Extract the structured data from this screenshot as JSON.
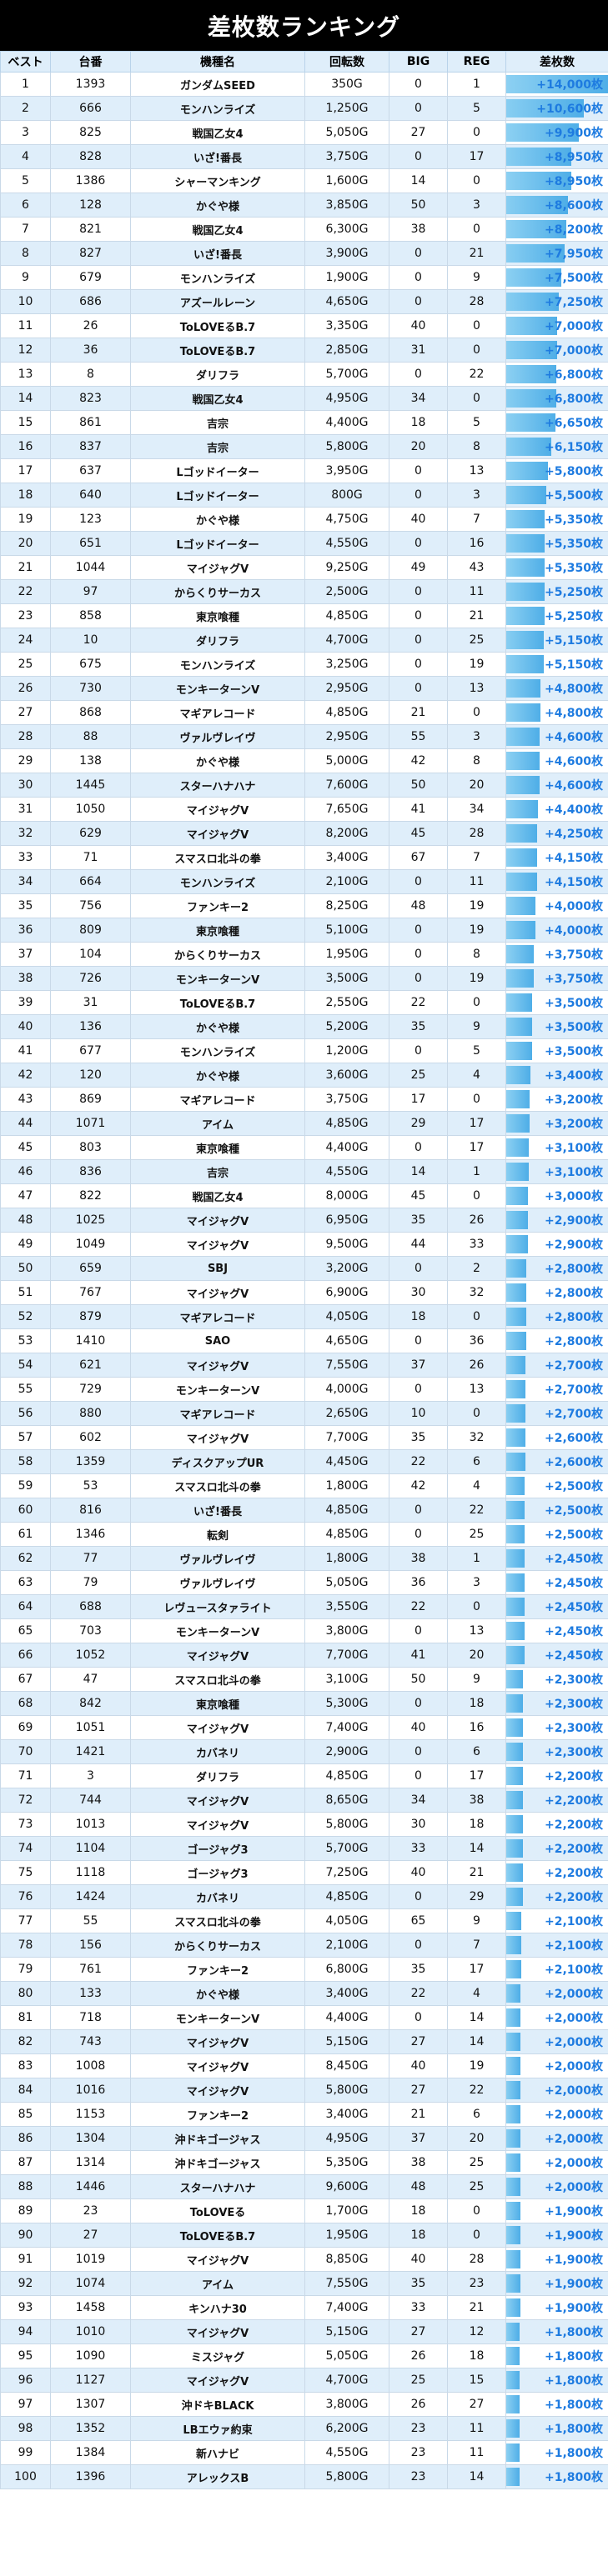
{
  "title": "差枚数ランキング",
  "headers": [
    "ベスト",
    "台番",
    "機種名",
    "回転数",
    "BIG",
    "REG",
    "差枚数"
  ],
  "colors": {
    "banner": "#000000",
    "header_bg": "#dfeefa",
    "stripe": "#dfeefa",
    "diff_text": "#1e7be0",
    "bar": "#5ab4e8"
  },
  "rows": [
    [
      "1",
      "1393",
      "ガンダムSEED",
      "350G",
      "0",
      "1",
      "+14,000枚"
    ],
    [
      "2",
      "666",
      "モンハンライズ",
      "1,250G",
      "0",
      "5",
      "+10,600枚"
    ],
    [
      "3",
      "825",
      "戦国乙女4",
      "5,050G",
      "27",
      "0",
      "+9,900枚"
    ],
    [
      "4",
      "828",
      "いざ!番長",
      "3,750G",
      "0",
      "17",
      "+8,950枚"
    ],
    [
      "5",
      "1386",
      "シャーマンキング",
      "1,600G",
      "14",
      "0",
      "+8,950枚"
    ],
    [
      "6",
      "128",
      "かぐや様",
      "3,850G",
      "50",
      "3",
      "+8,600枚"
    ],
    [
      "7",
      "821",
      "戦国乙女4",
      "6,300G",
      "38",
      "0",
      "+8,200枚"
    ],
    [
      "8",
      "827",
      "いざ!番長",
      "3,900G",
      "0",
      "21",
      "+7,950枚"
    ],
    [
      "9",
      "679",
      "モンハンライズ",
      "1,900G",
      "0",
      "9",
      "+7,500枚"
    ],
    [
      "10",
      "686",
      "アズールレーン",
      "4,650G",
      "0",
      "28",
      "+7,250枚"
    ],
    [
      "11",
      "26",
      "ToLOVEるB.7",
      "3,350G",
      "40",
      "0",
      "+7,000枚"
    ],
    [
      "12",
      "36",
      "ToLOVEるB.7",
      "2,850G",
      "31",
      "0",
      "+7,000枚"
    ],
    [
      "13",
      "8",
      "ダリフラ",
      "5,700G",
      "0",
      "22",
      "+6,800枚"
    ],
    [
      "14",
      "823",
      "戦国乙女4",
      "4,950G",
      "34",
      "0",
      "+6,800枚"
    ],
    [
      "15",
      "861",
      "吉宗",
      "4,400G",
      "18",
      "5",
      "+6,650枚"
    ],
    [
      "16",
      "837",
      "吉宗",
      "5,800G",
      "20",
      "8",
      "+6,150枚"
    ],
    [
      "17",
      "637",
      "Lゴッドイーター",
      "3,950G",
      "0",
      "13",
      "+5,800枚"
    ],
    [
      "18",
      "640",
      "Lゴッドイーター",
      "800G",
      "0",
      "3",
      "+5,500枚"
    ],
    [
      "19",
      "123",
      "かぐや様",
      "4,750G",
      "40",
      "7",
      "+5,350枚"
    ],
    [
      "20",
      "651",
      "Lゴッドイーター",
      "4,550G",
      "0",
      "16",
      "+5,350枚"
    ],
    [
      "21",
      "1044",
      "マイジャグV",
      "9,250G",
      "49",
      "43",
      "+5,350枚"
    ],
    [
      "22",
      "97",
      "からくりサーカス",
      "2,500G",
      "0",
      "11",
      "+5,250枚"
    ],
    [
      "23",
      "858",
      "東京喰種",
      "4,850G",
      "0",
      "21",
      "+5,250枚"
    ],
    [
      "24",
      "10",
      "ダリフラ",
      "4,700G",
      "0",
      "25",
      "+5,150枚"
    ],
    [
      "25",
      "675",
      "モンハンライズ",
      "3,250G",
      "0",
      "19",
      "+5,150枚"
    ],
    [
      "26",
      "730",
      "モンキーターンV",
      "2,950G",
      "0",
      "13",
      "+4,800枚"
    ],
    [
      "27",
      "868",
      "マギアレコード",
      "4,850G",
      "21",
      "0",
      "+4,800枚"
    ],
    [
      "28",
      "88",
      "ヴァルヴレイヴ",
      "2,950G",
      "55",
      "3",
      "+4,600枚"
    ],
    [
      "29",
      "138",
      "かぐや様",
      "5,000G",
      "42",
      "8",
      "+4,600枚"
    ],
    [
      "30",
      "1445",
      "スターハナハナ",
      "7,600G",
      "50",
      "20",
      "+4,600枚"
    ],
    [
      "31",
      "1050",
      "マイジャグV",
      "7,650G",
      "41",
      "34",
      "+4,400枚"
    ],
    [
      "32",
      "629",
      "マイジャグV",
      "8,200G",
      "45",
      "28",
      "+4,250枚"
    ],
    [
      "33",
      "71",
      "スマスロ北斗の拳",
      "3,400G",
      "67",
      "7",
      "+4,150枚"
    ],
    [
      "34",
      "664",
      "モンハンライズ",
      "2,100G",
      "0",
      "11",
      "+4,150枚"
    ],
    [
      "35",
      "756",
      "ファンキー2",
      "8,250G",
      "48",
      "19",
      "+4,000枚"
    ],
    [
      "36",
      "809",
      "東京喰種",
      "5,100G",
      "0",
      "19",
      "+4,000枚"
    ],
    [
      "37",
      "104",
      "からくりサーカス",
      "1,950G",
      "0",
      "8",
      "+3,750枚"
    ],
    [
      "38",
      "726",
      "モンキーターンV",
      "3,500G",
      "0",
      "19",
      "+3,750枚"
    ],
    [
      "39",
      "31",
      "ToLOVEるB.7",
      "2,550G",
      "22",
      "0",
      "+3,500枚"
    ],
    [
      "40",
      "136",
      "かぐや様",
      "5,200G",
      "35",
      "9",
      "+3,500枚"
    ],
    [
      "41",
      "677",
      "モンハンライズ",
      "1,200G",
      "0",
      "5",
      "+3,500枚"
    ],
    [
      "42",
      "120",
      "かぐや様",
      "3,600G",
      "25",
      "4",
      "+3,400枚"
    ],
    [
      "43",
      "869",
      "マギアレコード",
      "3,750G",
      "17",
      "0",
      "+3,200枚"
    ],
    [
      "44",
      "1071",
      "アイム",
      "4,850G",
      "29",
      "17",
      "+3,200枚"
    ],
    [
      "45",
      "803",
      "東京喰種",
      "4,400G",
      "0",
      "17",
      "+3,100枚"
    ],
    [
      "46",
      "836",
      "吉宗",
      "4,550G",
      "14",
      "1",
      "+3,100枚"
    ],
    [
      "47",
      "822",
      "戦国乙女4",
      "8,000G",
      "45",
      "0",
      "+3,000枚"
    ],
    [
      "48",
      "1025",
      "マイジャグV",
      "6,950G",
      "35",
      "26",
      "+2,900枚"
    ],
    [
      "49",
      "1049",
      "マイジャグV",
      "9,500G",
      "44",
      "33",
      "+2,900枚"
    ],
    [
      "50",
      "659",
      "SBJ",
      "3,200G",
      "0",
      "2",
      "+2,800枚"
    ],
    [
      "51",
      "767",
      "マイジャグV",
      "6,900G",
      "30",
      "32",
      "+2,800枚"
    ],
    [
      "52",
      "879",
      "マギアレコード",
      "4,050G",
      "18",
      "0",
      "+2,800枚"
    ],
    [
      "53",
      "1410",
      "SAO",
      "4,650G",
      "0",
      "36",
      "+2,800枚"
    ],
    [
      "54",
      "621",
      "マイジャグV",
      "7,550G",
      "37",
      "26",
      "+2,700枚"
    ],
    [
      "55",
      "729",
      "モンキーターンV",
      "4,000G",
      "0",
      "13",
      "+2,700枚"
    ],
    [
      "56",
      "880",
      "マギアレコード",
      "2,650G",
      "10",
      "0",
      "+2,700枚"
    ],
    [
      "57",
      "602",
      "マイジャグV",
      "7,700G",
      "35",
      "32",
      "+2,600枚"
    ],
    [
      "58",
      "1359",
      "ディスクアップUR",
      "4,450G",
      "22",
      "6",
      "+2,600枚"
    ],
    [
      "59",
      "53",
      "スマスロ北斗の拳",
      "1,800G",
      "42",
      "4",
      "+2,500枚"
    ],
    [
      "60",
      "816",
      "いざ!番長",
      "4,850G",
      "0",
      "22",
      "+2,500枚"
    ],
    [
      "61",
      "1346",
      "転剣",
      "4,850G",
      "0",
      "25",
      "+2,500枚"
    ],
    [
      "62",
      "77",
      "ヴァルヴレイヴ",
      "1,800G",
      "38",
      "1",
      "+2,450枚"
    ],
    [
      "63",
      "79",
      "ヴァルヴレイヴ",
      "5,050G",
      "36",
      "3",
      "+2,450枚"
    ],
    [
      "64",
      "688",
      "レヴュースタァライト",
      "3,550G",
      "22",
      "0",
      "+2,450枚"
    ],
    [
      "65",
      "703",
      "モンキーターンV",
      "3,800G",
      "0",
      "13",
      "+2,450枚"
    ],
    [
      "66",
      "1052",
      "マイジャグV",
      "7,700G",
      "41",
      "20",
      "+2,450枚"
    ],
    [
      "67",
      "47",
      "スマスロ北斗の拳",
      "3,100G",
      "50",
      "9",
      "+2,300枚"
    ],
    [
      "68",
      "842",
      "東京喰種",
      "5,300G",
      "0",
      "18",
      "+2,300枚"
    ],
    [
      "69",
      "1051",
      "マイジャグV",
      "7,400G",
      "40",
      "16",
      "+2,300枚"
    ],
    [
      "70",
      "1421",
      "カバネリ",
      "2,900G",
      "0",
      "6",
      "+2,300枚"
    ],
    [
      "71",
      "3",
      "ダリフラ",
      "4,850G",
      "0",
      "17",
      "+2,200枚"
    ],
    [
      "72",
      "744",
      "マイジャグV",
      "8,650G",
      "34",
      "38",
      "+2,200枚"
    ],
    [
      "73",
      "1013",
      "マイジャグV",
      "5,800G",
      "30",
      "18",
      "+2,200枚"
    ],
    [
      "74",
      "1104",
      "ゴージャグ3",
      "5,700G",
      "33",
      "14",
      "+2,200枚"
    ],
    [
      "75",
      "1118",
      "ゴージャグ3",
      "7,250G",
      "40",
      "21",
      "+2,200枚"
    ],
    [
      "76",
      "1424",
      "カバネリ",
      "4,850G",
      "0",
      "29",
      "+2,200枚"
    ],
    [
      "77",
      "55",
      "スマスロ北斗の拳",
      "4,050G",
      "65",
      "9",
      "+2,100枚"
    ],
    [
      "78",
      "156",
      "からくりサーカス",
      "2,100G",
      "0",
      "7",
      "+2,100枚"
    ],
    [
      "79",
      "761",
      "ファンキー2",
      "6,800G",
      "35",
      "17",
      "+2,100枚"
    ],
    [
      "80",
      "133",
      "かぐや様",
      "3,400G",
      "22",
      "4",
      "+2,000枚"
    ],
    [
      "81",
      "718",
      "モンキーターンV",
      "4,400G",
      "0",
      "14",
      "+2,000枚"
    ],
    [
      "82",
      "743",
      "マイジャグV",
      "5,150G",
      "27",
      "14",
      "+2,000枚"
    ],
    [
      "83",
      "1008",
      "マイジャグV",
      "8,450G",
      "40",
      "19",
      "+2,000枚"
    ],
    [
      "84",
      "1016",
      "マイジャグV",
      "5,800G",
      "27",
      "22",
      "+2,000枚"
    ],
    [
      "85",
      "1153",
      "ファンキー2",
      "3,400G",
      "21",
      "6",
      "+2,000枚"
    ],
    [
      "86",
      "1304",
      "沖ドキゴージャス",
      "4,950G",
      "37",
      "20",
      "+2,000枚"
    ],
    [
      "87",
      "1314",
      "沖ドキゴージャス",
      "5,350G",
      "38",
      "25",
      "+2,000枚"
    ],
    [
      "88",
      "1446",
      "スターハナハナ",
      "9,600G",
      "48",
      "25",
      "+2,000枚"
    ],
    [
      "89",
      "23",
      "ToLOVEる",
      "1,700G",
      "18",
      "0",
      "+1,900枚"
    ],
    [
      "90",
      "27",
      "ToLOVEるB.7",
      "1,950G",
      "18",
      "0",
      "+1,900枚"
    ],
    [
      "91",
      "1019",
      "マイジャグV",
      "8,850G",
      "40",
      "28",
      "+1,900枚"
    ],
    [
      "92",
      "1074",
      "アイム",
      "7,550G",
      "35",
      "23",
      "+1,900枚"
    ],
    [
      "93",
      "1458",
      "キンハナ30",
      "7,400G",
      "33",
      "21",
      "+1,900枚"
    ],
    [
      "94",
      "1010",
      "マイジャグV",
      "5,150G",
      "27",
      "12",
      "+1,800枚"
    ],
    [
      "95",
      "1090",
      "ミスジャグ",
      "5,050G",
      "26",
      "18",
      "+1,800枚"
    ],
    [
      "96",
      "1127",
      "マイジャグV",
      "4,700G",
      "25",
      "15",
      "+1,800枚"
    ],
    [
      "97",
      "1307",
      "沖ドキBLACK",
      "3,800G",
      "26",
      "27",
      "+1,800枚"
    ],
    [
      "98",
      "1352",
      "LBエウァ約束",
      "6,200G",
      "23",
      "11",
      "+1,800枚"
    ],
    [
      "99",
      "1384",
      "新ハナビ",
      "4,550G",
      "23",
      "11",
      "+1,800枚"
    ],
    [
      "100",
      "1396",
      "アレックスB",
      "5,800G",
      "23",
      "14",
      "+1,800枚"
    ]
  ]
}
